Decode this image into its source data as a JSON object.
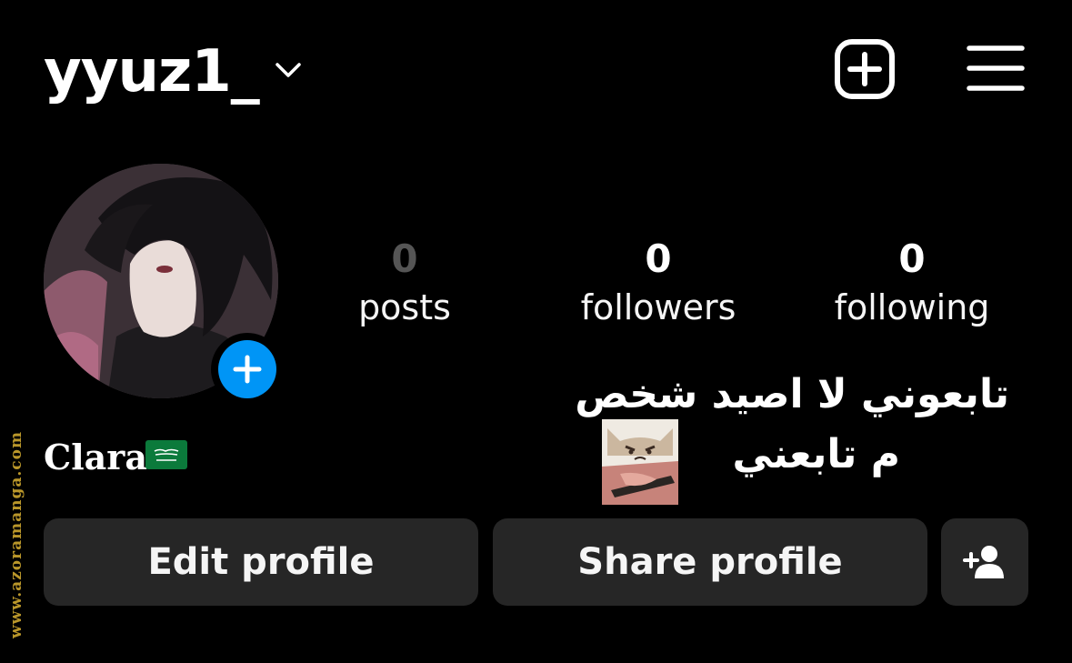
{
  "header": {
    "username": "yyuz1_",
    "chevron_icon": "chevron-down-icon",
    "create_icon": "plus-square-icon",
    "menu_icon": "menu-icon"
  },
  "profile": {
    "display_name": "Clara",
    "flag_icon": "saudi-flag-icon",
    "bio_line1": "تابعوني لا اصيد شخص",
    "bio_line2": "م تابعني"
  },
  "stats": [
    {
      "value": "0",
      "label": "posts"
    },
    {
      "value": "0",
      "label": "followers"
    },
    {
      "value": "0",
      "label": "following"
    }
  ],
  "buttons": {
    "edit": "Edit profile",
    "share": "Share profile",
    "discover_icon": "add-person-icon"
  },
  "colors": {
    "background": "#000000",
    "button": "#262626",
    "accent": "#0095f6",
    "watermark": "#b9962a"
  },
  "watermark": "www.azoramanga.com"
}
